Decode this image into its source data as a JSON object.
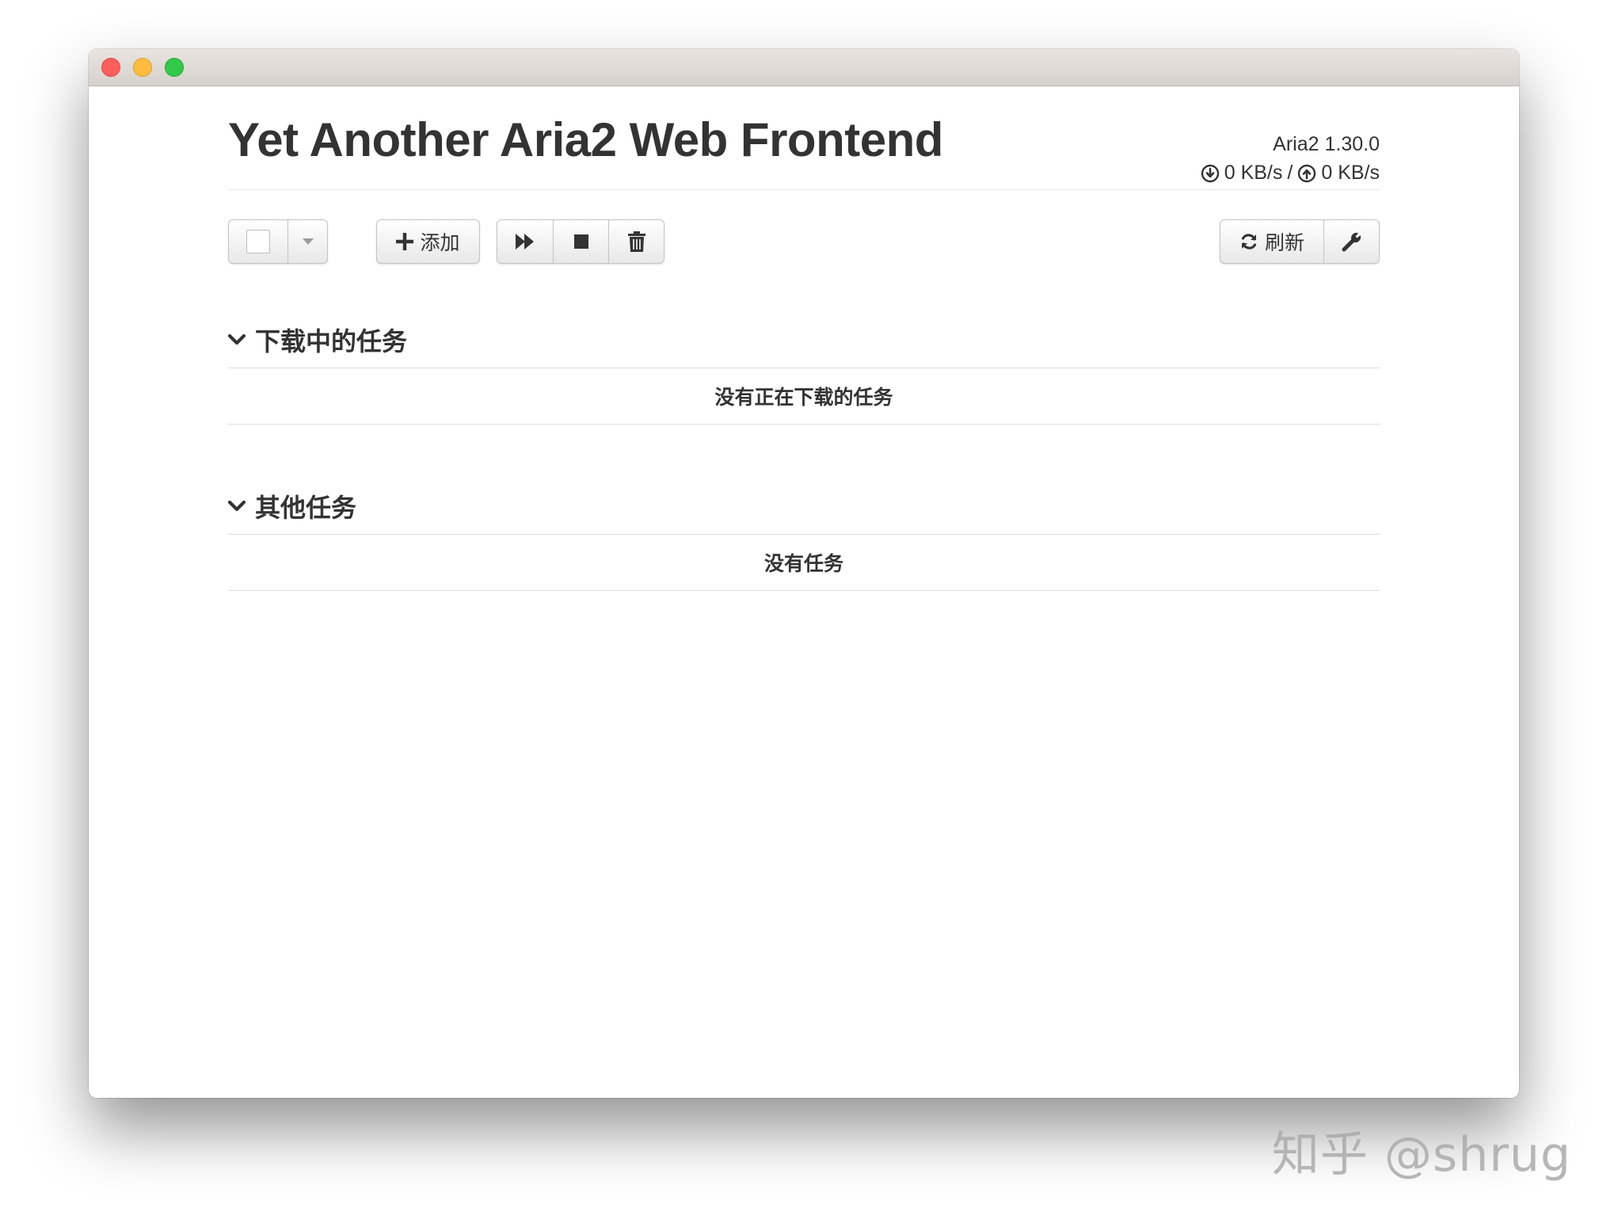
{
  "window": {
    "controls": {
      "close": "close",
      "minimize": "minimize",
      "zoom": "zoom"
    }
  },
  "header": {
    "title": "Yet Another Aria2 Web Frontend",
    "version": "Aria2 1.30.0",
    "download_speed": "0 KB/s",
    "speed_separator": "/",
    "upload_speed": "0 KB/s"
  },
  "toolbar": {
    "select_all_icon": "checkbox-icon",
    "select_menu_icon": "caret-down-icon",
    "add_label": "添加",
    "add_icon": "plus-icon",
    "start_icon": "fast-forward-icon",
    "pause_icon": "stop-icon",
    "remove_icon": "trash-icon",
    "refresh_label": "刷新",
    "refresh_icon": "refresh-icon",
    "settings_icon": "wrench-icon"
  },
  "sections": [
    {
      "title": "下载中的任务",
      "empty_text": "没有正在下载的任务",
      "icon": "chevron-down-icon"
    },
    {
      "title": "其他任务",
      "empty_text": "没有任务",
      "icon": "chevron-down-icon"
    }
  ],
  "watermark": "知乎 @shrug",
  "colors": {
    "text": "#333333",
    "border": "#c4c4c4",
    "divider": "#dddddd",
    "close": "#fc605c",
    "minimize": "#fdbc40",
    "zoom": "#34c84a"
  }
}
